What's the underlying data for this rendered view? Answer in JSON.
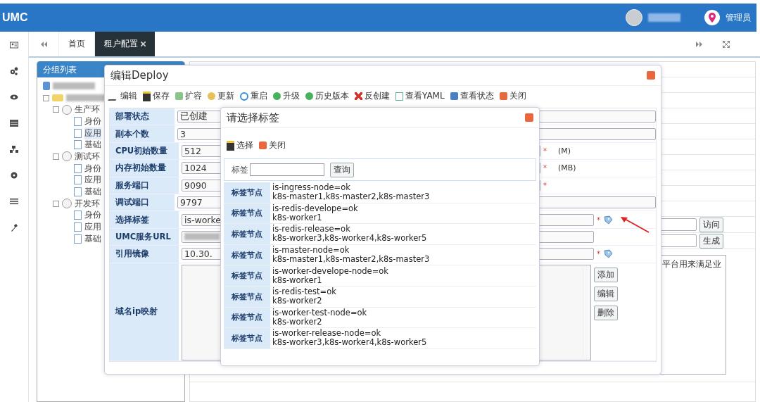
{
  "header": {
    "logo": "UMC",
    "user_role": "管理员"
  },
  "tabs": [
    {
      "label": "首页",
      "selected": false
    },
    {
      "label": "租户配置",
      "selected": true
    }
  ],
  "group_panel": {
    "title": "分组列表",
    "tree": [
      {
        "label": "生产环",
        "children": [
          {
            "label": "身份",
            "selected": false
          },
          {
            "label": "应用",
            "selected": true
          },
          {
            "label": "基础",
            "selected": false
          }
        ]
      },
      {
        "label": "测试环",
        "children": [
          {
            "label": "身份",
            "selected": false
          },
          {
            "label": "应用",
            "selected": false
          },
          {
            "label": "基础",
            "selected": false
          }
        ]
      },
      {
        "label": "开发环",
        "children": [
          {
            "label": "身份",
            "selected": false
          },
          {
            "label": "应用",
            "selected": false
          },
          {
            "label": "基础",
            "selected": false
          }
        ]
      }
    ]
  },
  "background_form": {
    "buttons": [
      "访问",
      "生成"
    ],
    "description": "平台用来满足业"
  },
  "deploy_dialog": {
    "title": "编辑Deploy",
    "toolbar": [
      "编辑",
      "保存",
      "扩容",
      "更新",
      "重启",
      "升级",
      "历史版本",
      "反创建",
      "查看YAML",
      "查看状态",
      "关闭"
    ],
    "fields": [
      {
        "kind": "plain",
        "label": "部署状态",
        "value": "已创建"
      },
      {
        "kind": "plain",
        "label": "副本个数",
        "value": "3"
      },
      {
        "kind": "unit",
        "label": "CPU初始数量",
        "value": "512",
        "required_mark": "*",
        "unit": "(M)"
      },
      {
        "kind": "unit",
        "label": "内存初始数量",
        "value": "1024",
        "required_mark": "*",
        "unit": "(MB)"
      },
      {
        "kind": "unit",
        "label": "服务端口",
        "value": "9090",
        "required_mark": "*"
      },
      {
        "kind": "plain",
        "label": "调试端口",
        "value": "9797"
      },
      {
        "kind": "picker",
        "label": "选择标签",
        "value": "is-worke",
        "required_mark": "*"
      },
      {
        "kind": "blurred",
        "label": "UMC服务URL"
      },
      {
        "kind": "picker",
        "label": "引用镜像",
        "value": "10.30.",
        "required_mark": "*"
      },
      {
        "kind": "list",
        "label": "域名ip映射",
        "buttons": [
          "添加",
          "编辑",
          "删除"
        ]
      }
    ]
  },
  "tag_dialog": {
    "title": "请选择标签",
    "toolbar": [
      "选择",
      "关闭"
    ],
    "search_label": "标签",
    "search_button": "查询",
    "rows": [
      {
        "label": "标签节点",
        "tag": "is-ingress-node=ok",
        "nodes": "k8s-master1,k8s-master2,k8s-master3"
      },
      {
        "label": "标签节点",
        "tag": "is-redis-develope=ok",
        "nodes": "k8s-worker1"
      },
      {
        "label": "标签节点",
        "tag": "is-redis-release=ok",
        "nodes": "k8s-worker3,k8s-worker4,k8s-worker5"
      },
      {
        "label": "标签节点",
        "tag": "is-master-node=ok",
        "nodes": "k8s-master1,k8s-master2,k8s-master3"
      },
      {
        "label": "标签节点",
        "tag": "is-worker-develope-node=ok",
        "nodes": "k8s-worker1"
      },
      {
        "label": "标签节点",
        "tag": "is-redis-test=ok",
        "nodes": "k8s-worker2"
      },
      {
        "label": "标签节点",
        "tag": "is-worker-test-node=ok",
        "nodes": "k8s-worker2"
      },
      {
        "label": "标签节点",
        "tag": "is-worker-release-node=ok",
        "nodes": "k8s-worker3,k8s-worker4,k8s-worker5"
      }
    ]
  }
}
